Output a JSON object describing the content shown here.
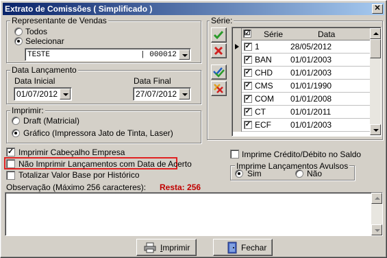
{
  "window": {
    "title": "Extrato de Comissões ( Simplificado )",
    "close_label": "✕"
  },
  "representante": {
    "group_label": "Representante de Vendas",
    "todos_label": "Todos",
    "selecionar_label": "Selecionar",
    "selected": "selecionar",
    "combo_value": "TESTE                    | 000012 |"
  },
  "data_lancamento": {
    "group_label": "Data Lançamento",
    "inicial_label": "Data Inicial",
    "inicial_value": "01/07/2012",
    "final_label": "Data Final",
    "final_value": "27/07/2012"
  },
  "imprimir_group": {
    "group_label": "Imprimir:",
    "draft_label": "Draft (Matricial)",
    "grafico_label": "Gráfico (Impressora Jato de Tinta, Laser)",
    "selected": "grafico"
  },
  "serie": {
    "group_label": "Série:",
    "columns": [
      "Série",
      "Data"
    ],
    "rows": [
      {
        "serie": "1",
        "data": "28/05/2012",
        "checked": true,
        "current": true
      },
      {
        "serie": "BAN",
        "data": "01/01/2003",
        "checked": true
      },
      {
        "serie": "CHD",
        "data": "01/01/2003",
        "checked": true
      },
      {
        "serie": "CMS",
        "data": "01/01/1990",
        "checked": true
      },
      {
        "serie": "COM",
        "data": "01/01/2008",
        "checked": true
      },
      {
        "serie": "CT",
        "data": "01/01/2011",
        "checked": true
      },
      {
        "serie": "ECF",
        "data": "01/01/2003",
        "checked": true
      }
    ]
  },
  "options": {
    "cabecalho_label": "Imprimir Cabeçalho Empresa",
    "cabecalho_checked": true,
    "nao_imprimir_label": "Não Imprimir Lançamentos com Data de Acerto",
    "nao_imprimir_checked": false,
    "totalizar_label": "Totalizar Valor Base por Histórico",
    "totalizar_checked": false,
    "credito_debito_label": "Imprime Crédito/Débito no Saldo",
    "credito_debito_checked": false
  },
  "avulsos": {
    "group_label": "Imprime Lançamentos Avulsos",
    "sim_label": "Sim",
    "nao_label": "Não",
    "selected": "sim"
  },
  "observacao": {
    "label": "Observação (Máximo 256 caracteres):",
    "resta_label": "Resta: 256",
    "value": ""
  },
  "buttons": {
    "imprimir_label": "Imprimir",
    "fechar_label": "Fechar"
  },
  "colors": {
    "highlight_box": "#e02020",
    "resta_text": "#c00000",
    "title_start": "#0a246a",
    "title_end": "#a6caf0"
  }
}
